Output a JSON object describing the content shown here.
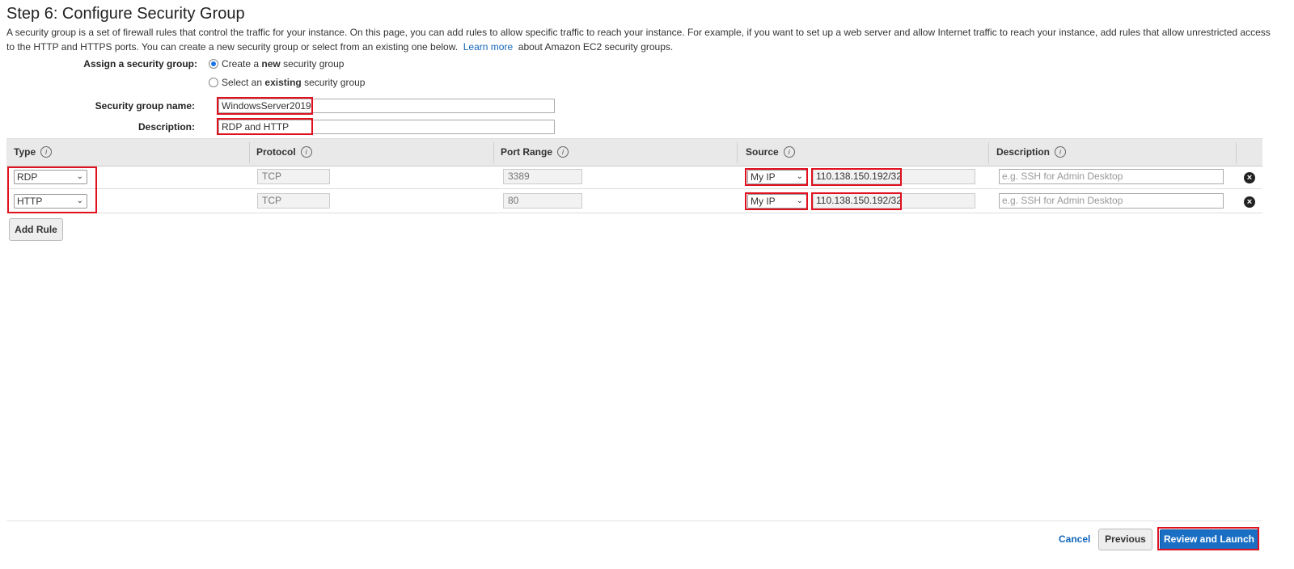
{
  "page": {
    "title": "Step 6: Configure Security Group",
    "intro_text": "A security group is a set of firewall rules that control the traffic for your instance. On this page, you can add rules to allow specific traffic to reach your instance. For example, if you want to set up a web server and allow Internet traffic to reach your instance, add rules that allow unrestricted access to the HTTP and HTTPS ports. You can create a new security group or select from an existing one below.",
    "learn_more": "Learn more",
    "intro_suffix": "about Amazon EC2 security groups."
  },
  "assign": {
    "label": "Assign a security group:",
    "option_new_prefix": "Create a",
    "option_new_bold": "new",
    "option_new_suffix": "security group",
    "option_existing_prefix": "Select an",
    "option_existing_bold": "existing",
    "option_existing_suffix": "security group",
    "selected": "new"
  },
  "form": {
    "name_label": "Security group name:",
    "name_value": "WindowsServer2019",
    "desc_label": "Description:",
    "desc_value": "RDP and HTTP"
  },
  "table": {
    "headers": [
      "Type",
      "Protocol",
      "Port Range",
      "Source",
      "Description"
    ],
    "rows": [
      {
        "type": "RDP",
        "protocol": "TCP",
        "port": "3389",
        "source": "My IP",
        "ip": "110.138.150.192/32",
        "desc_placeholder": "e.g. SSH for Admin Desktop"
      },
      {
        "type": "HTTP",
        "protocol": "TCP",
        "port": "80",
        "source": "My IP",
        "ip": "110.138.150.192/32",
        "desc_placeholder": "e.g. SSH for Admin Desktop"
      }
    ],
    "add_rule": "Add Rule"
  },
  "footer": {
    "cancel": "Cancel",
    "previous": "Previous",
    "review_launch": "Review and Launch"
  },
  "colors": {
    "accent": "#1a6fc4",
    "highlight": "#e0101e",
    "link": "#1166bb"
  }
}
